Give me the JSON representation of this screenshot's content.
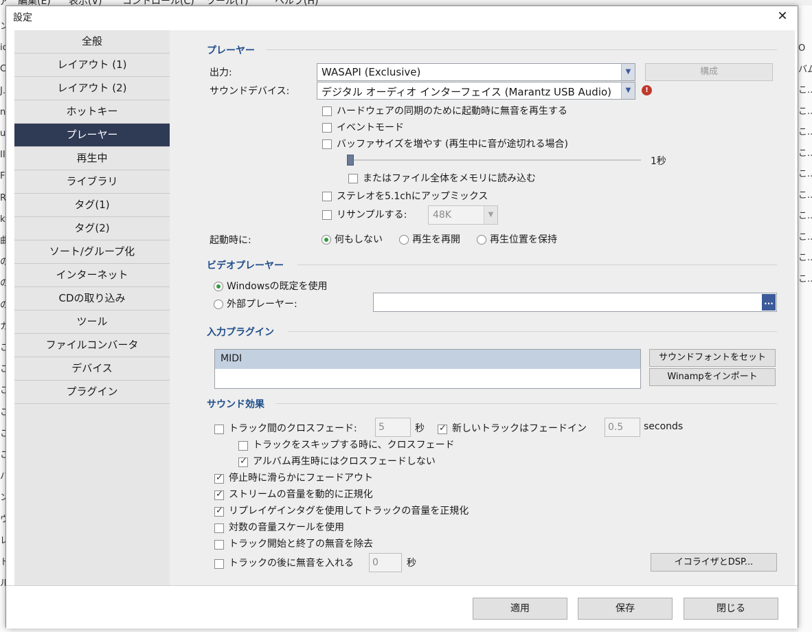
{
  "background": {
    "menubar": [
      "ァ",
      "編集(E)",
      "表示(V)",
      "コントロール(C)",
      "ツール(T)",
      "ヘルプ(H)"
    ],
    "left_fragments": [
      "ン",
      "ic",
      "C.",
      "J.\\",
      "nm",
      "us",
      "II,",
      "F",
      "R",
      "ky",
      "曲",
      "の",
      "の",
      "の",
      "カス",
      "こ",
      "こ",
      "こ",
      "こ",
      "こ",
      "こ",
      "パ",
      "ン",
      "ウ",
      "レ",
      "ト",
      "ル"
    ],
    "right_fragments": [
      "O",
      "バム",
      "こ...",
      "こ...",
      "こ...",
      "こ...",
      "こ...",
      "こ...",
      "こ...",
      "こ...",
      "こ...",
      "こ..."
    ]
  },
  "dialog": {
    "title": "設定",
    "close_glyph": "✕"
  },
  "sidebar": {
    "items": [
      {
        "label": "全般"
      },
      {
        "label": "レイアウト (1)"
      },
      {
        "label": "レイアウト (2)"
      },
      {
        "label": "ホットキー"
      },
      {
        "label": "プレーヤー",
        "active": true
      },
      {
        "label": "再生中"
      },
      {
        "label": "ライブラリ"
      },
      {
        "label": "タグ(1)"
      },
      {
        "label": "タグ(2)"
      },
      {
        "label": "ソート/グループ化"
      },
      {
        "label": "インターネット"
      },
      {
        "label": "CDの取り込み"
      },
      {
        "label": "ツール"
      },
      {
        "label": "ファイルコンバータ"
      },
      {
        "label": "デバイス"
      },
      {
        "label": "プラグイン"
      }
    ]
  },
  "player": {
    "title": "プレーヤー",
    "output_label": "出力:",
    "output_value": "WASAPI (Exclusive)",
    "config_button": "構成",
    "device_label": "サウンドデバイス:",
    "device_value": "デジタル オーディオ インターフェイス (Marantz USB Audio)",
    "warning_glyph": "!",
    "opt_hw_sync": "ハードウェアの同期のために起動時に無音を再生する",
    "opt_event_mode": "イベントモード",
    "opt_buffer": "バッファサイズを増やす (再生中に音が途切れる場合)",
    "buffer_value": "1秒",
    "buffer_level": 0.0,
    "opt_load_memory": "またはファイル全体をメモリに読み込む",
    "opt_upmix": "ステレオを5.1chにアップミックス",
    "opt_resample": "リサンプルする:",
    "resample_value": "48K",
    "startup_label": "起動時に:",
    "startup_options": [
      "何もしない",
      "再生を再開",
      "再生位置を保持"
    ],
    "startup_selected": "何もしない"
  },
  "video": {
    "title": "ビデオプレーヤー",
    "opt_default": "Windowsの既定を使用",
    "opt_external": "外部プレーヤー:",
    "browse_label": "..."
  },
  "input_plugins": {
    "title": "入力プラグイン",
    "items": [
      "MIDI"
    ],
    "soundfont_button": "サウンドフォントをセット",
    "winamp_button": "Winampをインポート"
  },
  "sound_effects": {
    "title": "サウンド効果",
    "crossfade_label": "トラック間のクロスフェード:",
    "crossfade_value": "5",
    "crossfade_unit": "秒",
    "fadein_label": "新しいトラックはフェードイン",
    "fadein_value": "0.5",
    "fadein_unit": "seconds",
    "skip_crossfade": "トラックをスキップする時に、クロスフェード",
    "album_no_crossfade": "アルバム再生時にはクロスフェードしない",
    "fade_out_stop": "停止時に滑らかにフェードアウト",
    "normalize_stream": "ストリームの音量を動的に正規化",
    "replaygain": "リプレイゲインタグを使用してトラックの音量を正規化",
    "log_volume": "対数の音量スケールを使用",
    "remove_silence": "トラック開始と終了の無音を除去",
    "insert_silence_label": "トラックの後に無音を入れる",
    "insert_silence_value": "0",
    "insert_silence_unit": "秒",
    "eq_button": "イコライザとDSP..."
  },
  "footer": {
    "apply": "適用",
    "save": "保存",
    "close": "閉じる"
  }
}
